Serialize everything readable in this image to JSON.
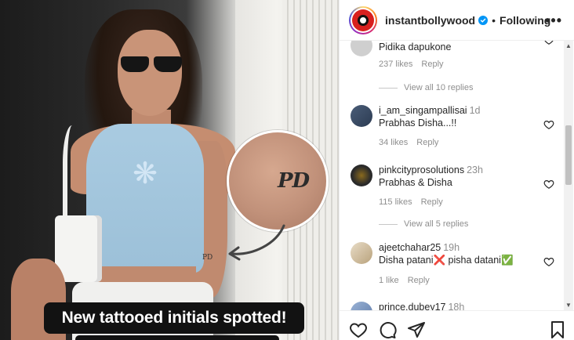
{
  "post": {
    "overlay_caption": "New tattooed initials spotted!",
    "tattoo_text": "PD"
  },
  "header": {
    "username": "instantbollywood",
    "separator": "•",
    "follow_status": "Following",
    "more_icon": "more-horizontal-icon"
  },
  "comments": [
    {
      "username": "",
      "time": "",
      "text": "Pidika dapukone",
      "likes": "237 likes",
      "reply": "Reply"
    },
    {
      "username": "i_am_singampallisai",
      "time": "1d",
      "text": "Prabhas Disha...!!",
      "likes": "34 likes",
      "reply": "Reply"
    },
    {
      "username": "pinkcityprosolutions",
      "time": "23h",
      "text": "Prabhas & Disha",
      "likes": "115 likes",
      "reply": "Reply"
    },
    {
      "username": "ajeetchahar25",
      "time": "19h",
      "text": "Disha patani❌ pisha datani✅",
      "likes": "1 like",
      "reply": "Reply"
    },
    {
      "username": "prince.dubey17",
      "time": "18h",
      "text": "",
      "likes": "",
      "reply": ""
    }
  ],
  "view_replies": [
    "View all 10 replies",
    "View all 5 replies"
  ],
  "colors": {
    "verified": "#0095f6",
    "text": "#262626",
    "muted": "#8e8e8e",
    "caption_bg": "#121212"
  }
}
